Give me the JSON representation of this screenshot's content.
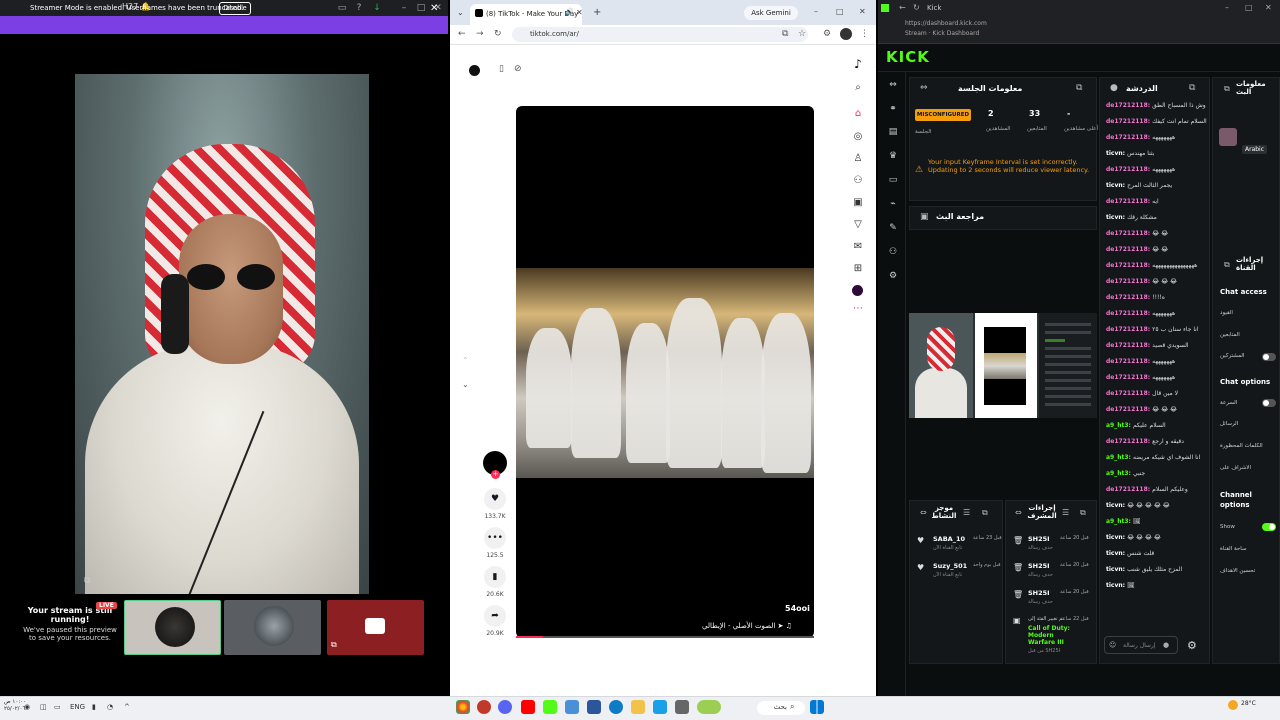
{
  "left_window": {
    "title": "H27 🔔",
    "banner": {
      "text": "Streamer Mode is enabled. Usernames have been truncated.",
      "button": "Disable"
    },
    "paused": {
      "title": "Your stream is still running!",
      "subtitle": "We've paused this preview to save your resources.",
      "live": "LIVE"
    }
  },
  "chrome": {
    "tab_title": "(8) TikTok - Make Your Day",
    "gemini": "Ask Gemini",
    "url": "tiktok.com/ar/"
  },
  "tiktok": {
    "author": "54ooi",
    "sound": "♫ ➤ الصوت الأصلي - الإيطالي",
    "likes": "133.7K",
    "comments": "125.5",
    "saves": "20.6K",
    "shares": "20.9K",
    "follow": "+",
    "progress": 0.09
  },
  "kick": {
    "window_title": "Kick",
    "url": "https://dashboard.kick.com",
    "subtitle": "Stream · Kick Dashboard",
    "logo": "KICK",
    "session": {
      "title": "معلومات الجلسة",
      "status": "MISCONFIGURED",
      "status_label": "الجلسة",
      "stats": [
        {
          "value": "2",
          "label": "المشاهدين"
        },
        {
          "value": "33",
          "label": "المتابعين"
        },
        {
          "value": "-",
          "label": "أعلى مشاهدين"
        }
      ],
      "warning": "Your input Keyframe Interval is set incorrectly. Updating to 2 seconds will reduce viewer latency."
    },
    "review_title": "مراجعة البث",
    "mod": {
      "title": "موجز النشاط",
      "events": [
        {
          "name": "SABA_10",
          "sub": "تابع القناة الآن",
          "time": "قبل 23 ساعة"
        },
        {
          "name": "Suzy_501",
          "sub": "تابع القناة الآن",
          "time": "قبل يوم واحد"
        }
      ]
    },
    "actions": {
      "title": "إجراءات المشرف",
      "events": [
        {
          "name": "SH25I",
          "sub": "حذف رسالة",
          "time": "قبل 20 ساعة"
        },
        {
          "name": "SH25I",
          "sub": "حذف رسالة",
          "time": "قبل 20 ساعة"
        },
        {
          "name": "SH25I",
          "sub": "حذف رسالة",
          "time": "قبل 20 ساعة"
        }
      ],
      "last": {
        "prefix": "تم تغيير الفئة إلى",
        "category": "Call of Duty: Modern Warfare III",
        "by": "من قبل SH25I",
        "time": "قبل 22 ساعة"
      }
    },
    "chat": {
      "title": "الدردشة",
      "input_placeholder": "إرسال رسالة",
      "messages": [
        {
          "user": "de17212118:",
          "text": "وش ذا المسباح الطق",
          "color": "#f472d0"
        },
        {
          "user": "de17212118:",
          "text": "السلام تمام انت كيفك",
          "color": "#f472d0"
        },
        {
          "user": "de17212118:",
          "text": "هههههههه",
          "color": "#f472d0"
        },
        {
          "user": "ticvn:",
          "text": "بثنا مهندس",
          "color": "#ffffff"
        },
        {
          "user": "de17212118:",
          "text": "هههههههه",
          "color": "#f472d0"
        },
        {
          "user": "ticvn:",
          "text": "يجمر الثالث المرح",
          "color": "#ffffff"
        },
        {
          "user": "de17212118:",
          "text": "ايه",
          "color": "#f472d0"
        },
        {
          "user": "ticvn:",
          "text": "مشكلة رقك",
          "color": "#ffffff"
        },
        {
          "user": "de17212118:",
          "text": "😂 😂",
          "color": "#f472d0"
        },
        {
          "user": "de17212118:",
          "text": "😂 😂",
          "color": "#f472d0"
        },
        {
          "user": "de17212118:",
          "text": "هههههههههههههههه",
          "color": "#f472d0"
        },
        {
          "user": "de17212118:",
          "text": "😂 😂 😂",
          "color": "#f472d0"
        },
        {
          "user": "de17212118:",
          "text": "!!!!ه",
          "color": "#f472d0"
        },
        {
          "user": "de17212118:",
          "text": "هههههههه",
          "color": "#f472d0"
        },
        {
          "user": "de17212118:",
          "text": "انا جاء سنان ب ٢٥",
          "color": "#f472d0"
        },
        {
          "user": "de17212118:",
          "text": "السويدي قصيد",
          "color": "#f472d0"
        },
        {
          "user": "de17212118:",
          "text": "هههههههه",
          "color": "#f472d0"
        },
        {
          "user": "de17212118:",
          "text": "هههههههه",
          "color": "#f472d0"
        },
        {
          "user": "de17212118:",
          "text": "لا مين قال",
          "color": "#f472d0"
        },
        {
          "user": "de17212118:",
          "text": "😂 😂 😂",
          "color": "#f472d0"
        },
        {
          "user": "a9_ht3:",
          "text": "السلام عليكم",
          "color": "#53fc18"
        },
        {
          "user": "de17212118:",
          "text": "دقيقه و ارجع",
          "color": "#f472d0"
        },
        {
          "user": "a9_ht3:",
          "text": "انا الشوف اي شيكه مريضه",
          "color": "#53fc18"
        },
        {
          "user": "a9_ht3:",
          "text": "جنبي",
          "color": "#53fc18"
        },
        {
          "user": "de17212118:",
          "text": "وعليكم السلام",
          "color": "#f472d0"
        },
        {
          "user": "ticvn:",
          "text": "😂 😂 😂 😂 😂",
          "color": "#ffffff"
        },
        {
          "user": "a9_ht3:",
          "text": "🖼",
          "color": "#53fc18"
        },
        {
          "user": "ticvn:",
          "text": "😂 😂 😂 😂",
          "color": "#ffffff"
        },
        {
          "user": "ticvn:",
          "text": "قلت شنس",
          "color": "#ffffff"
        },
        {
          "user": "ticvn:",
          "text": "المزح مثلك يليق شنب",
          "color": "#ffffff"
        },
        {
          "user": "ticvn:",
          "text": "🖼",
          "color": "#ffffff"
        }
      ]
    },
    "right_panel": {
      "info_title": "معلومات البث",
      "lang_label": "Arabic",
      "actions_title": "إجراءات القناة",
      "chat_access": "Chat access",
      "chat_access_items": [
        "القيود",
        "المتابعين",
        "المشتركين"
      ],
      "chat_options": "Chat options",
      "chat_options_items": [
        "السرعة",
        "الرسائل",
        "الكلمات المحظورة",
        "الاشراف على"
      ],
      "channel_options": "Channel options",
      "channel_options_items": [
        "Show",
        "ساحة القناة",
        "تحسين الاهداف"
      ]
    }
  },
  "taskbar": {
    "search": "بحث",
    "weather": "28°C",
    "lang": "ENG",
    "clock_time": "١٠:٠٠ ص",
    "clock_date": "٢٥/٠٢/٠٦"
  }
}
